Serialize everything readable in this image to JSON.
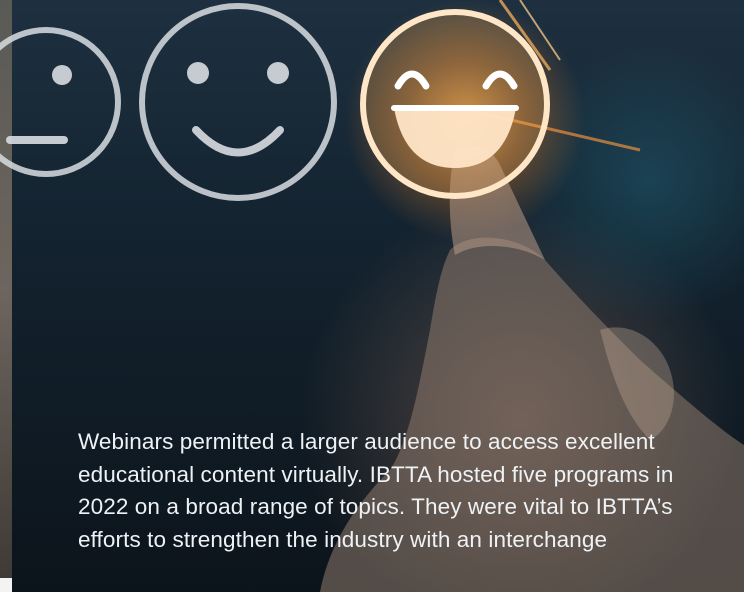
{
  "caption": {
    "text": "Webinars permitted a larger audience to access excellent educational content virtually. IBTTA hosted five programs in 2022 on a broad range of topics. They were vital to IBTTA’s efforts to strengthen the industry with an interchange"
  },
  "icons": {
    "neutral": "neutral-face-icon",
    "smiling": "smiling-face-icon",
    "laughing": "laughing-face-icon"
  },
  "colors": {
    "caption_text": "#eef2f5",
    "glow": "#ffb45a",
    "outline": "#d8dde2"
  }
}
